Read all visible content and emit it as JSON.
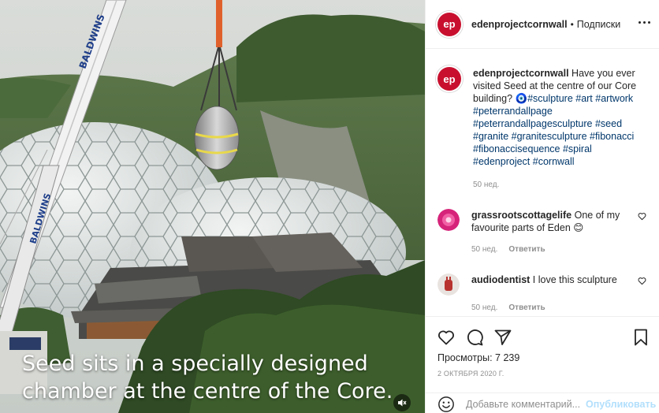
{
  "media": {
    "crane_brand": "BALDWINS",
    "caption_lines": [
      "Seed sits in a specially designed",
      "chamber at the centre of the Core."
    ]
  },
  "header": {
    "avatar_text": "ep",
    "username": "edenprojectcornwall",
    "separator": "•",
    "follow_label": "Подписки"
  },
  "post_caption": {
    "username": "edenprojectcornwall",
    "text": "Have you ever visited Seed at the centre of our Core building? ",
    "emoji": "🧿",
    "hashtags": "#sculpture #art #artwork #peterrandallpage #peterrandallpagesculpture #seed #granite #granitesculpture #fibonacci #fibonaccisequence #spiral #edenproject #cornwall",
    "time": "50 нед."
  },
  "comments": [
    {
      "username": "grassrootscottagelife",
      "text": "One of my favourite parts of Eden ",
      "emoji": "😊",
      "time": "50 нед.",
      "reply_label": "Ответить",
      "avatar_color": "#d6247a"
    },
    {
      "username": "audiodentist",
      "text": "I love this sculpture",
      "emoji": "",
      "time": "50 нед.",
      "reply_label": "Ответить",
      "avatar_color": "#b8332f"
    }
  ],
  "actions": {
    "like_icon": "heart-icon",
    "comment_icon": "comment-icon",
    "share_icon": "paper-plane-icon",
    "save_icon": "bookmark-icon",
    "views": "Просмотры: 7 239",
    "date": "2 ОКТЯБРЯ 2020 Г."
  },
  "add_comment": {
    "placeholder": "Добавьте комментарий...",
    "publish_label": "Опубликовать"
  },
  "colors": {
    "brand_red": "#c8102e",
    "link_blue": "#00376b",
    "publish_disabled": "#b2dffc",
    "muted": "#8e8e8e"
  }
}
